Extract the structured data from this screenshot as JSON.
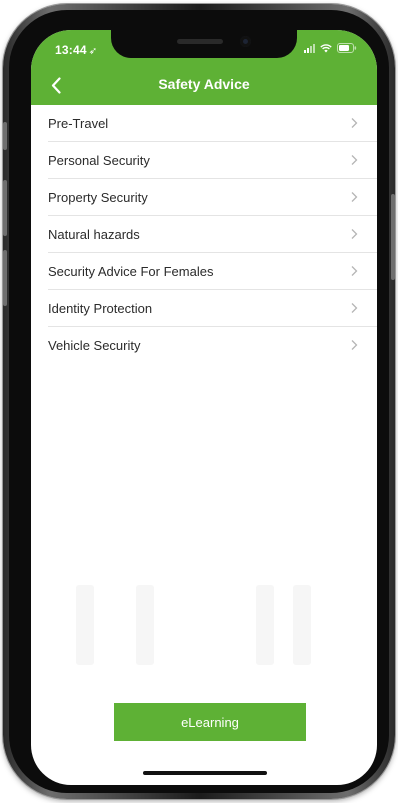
{
  "status_bar": {
    "time": "13:44",
    "location_glyph": "➶",
    "icons": [
      "signal-icon",
      "wifi-icon",
      "battery-icon"
    ]
  },
  "nav": {
    "back_icon": "chevron-left-icon",
    "title": "Safety Advice"
  },
  "list": {
    "items": [
      {
        "label": "Pre-Travel"
      },
      {
        "label": "Personal Security"
      },
      {
        "label": "Property Security"
      },
      {
        "label": "Natural hazards"
      },
      {
        "label": "Security Advice For Females"
      },
      {
        "label": "Identity Protection"
      },
      {
        "label": "Vehicle Security"
      }
    ],
    "chevron_icon": "chevron-right-icon"
  },
  "footer": {
    "elearning_label": "eLearning"
  },
  "colors": {
    "accent": "#5eb135",
    "text": "#2b2b2b",
    "divider": "#e4e4e4",
    "chevron": "#b5b5b5"
  }
}
